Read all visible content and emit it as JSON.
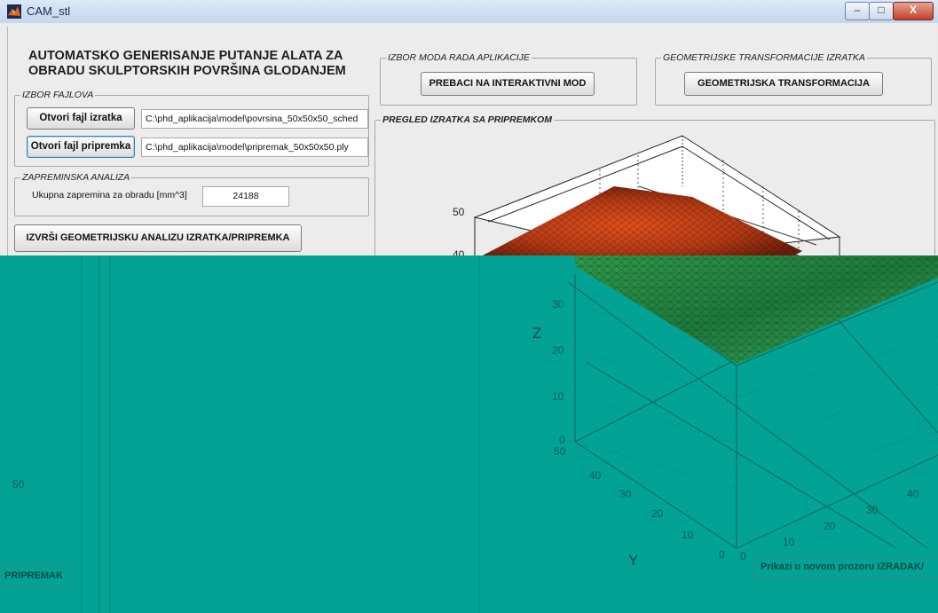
{
  "window": {
    "title": "CAM_stl",
    "min_glyph": "–",
    "max_glyph": "□",
    "close_glyph": "X",
    "icon": "matlab-icon"
  },
  "main": {
    "title": "AUTOMATSKO GENERISANJE PUTANJE ALATA ZA OBRADU SKULPTORSKIH POVRŠINA GLODANJEM"
  },
  "files_panel": {
    "legend": "IZBOR FAJLOVA",
    "open_part_label": "Otvori fajl izratka",
    "part_path": "C:\\phd_aplikacija\\model\\povrsina_50x50x50_sched",
    "open_stock_label": "Otvori fajl pripremka",
    "stock_path": "C:\\phd_aplikacija\\model\\pripremak_50x50x50.ply"
  },
  "volume_panel": {
    "legend": "ZAPREMINSKA ANALIZA",
    "label": "Ukupna zapremina za obradu [mm^3]",
    "value": "24188"
  },
  "analysis_button": "IZVRŠI GEOMETRIJSKU ANALIZU IZRATKA/PRIPREMKA",
  "mode_panel": {
    "legend": "IZBOR MODA RADA APLIKACIJE",
    "button": "PREBACI NA INTERAKTIVNI MOD"
  },
  "geo_panel": {
    "legend": "GEOMETRIJSKE TRANSFORMACIJE IZRATKA",
    "button": "GEOMETRIJSKA TRANSFORMACIJA"
  },
  "preview_panel": {
    "legend": "PREGLED IZRATKA SA PRIPREMKOM",
    "tick_50": "50",
    "tick_40": "40"
  },
  "overlay": {
    "color": "#02a394",
    "z_label": "Z",
    "y_label": "Y",
    "z_ticks": [
      "30",
      "20",
      "10",
      "0"
    ],
    "y_ticks": [
      "50",
      "40",
      "30",
      "20",
      "10",
      "0"
    ],
    "x_ticks": [
      "0",
      "10",
      "20",
      "30",
      "40"
    ],
    "left_tick": "50",
    "left_button": "PRIPREMAK",
    "right_button": "Prikazi u novom prozoru IZRADAK/"
  },
  "colors": {
    "part_surface": "#c8491c",
    "titlebar": "#c3d7ef",
    "close_button": "#c1402a"
  }
}
